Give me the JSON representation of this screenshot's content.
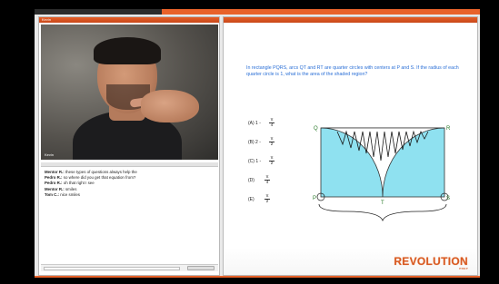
{
  "app": {
    "menu_label": "",
    "bottom_accent": "#e8622a"
  },
  "left": {
    "title": "Kevin",
    "video": {
      "caption": "Kevin"
    },
    "chat": {
      "header": "",
      "messages": [
        {
          "name": "",
          "text": ""
        },
        {
          "name": "Mentor R.:",
          "text": "these types of questions always help the"
        },
        {
          "name": "Pedro R.:",
          "text": "so where did you get that equation from?"
        },
        {
          "name": "Pedro R.:",
          "text": "oh that right I see"
        },
        {
          "name": "Mentor R.:",
          "text": "smiles"
        },
        {
          "name": "Tom C.:",
          "text": "nice smiles"
        }
      ],
      "send_label": ""
    }
  },
  "right": {
    "title": "",
    "question": "In rectangle PQRS, arcs QT and RT are quarter circles with centers at P and S. If the radius of each quarter circle is 1, what is the area of the shaded region?",
    "choices": [
      {
        "label": "(A)  1 -",
        "num": "π",
        "den": "4"
      },
      {
        "label": "(B)  2 -",
        "num": "π",
        "den": "2"
      },
      {
        "label": "(C)  1 -",
        "num": "π",
        "den": "2"
      },
      {
        "label": "(D)",
        "num": "π",
        "den": "4"
      },
      {
        "label": "(E)",
        "num": "π",
        "den": "2"
      }
    ],
    "figure": {
      "points": [
        "Q",
        "R",
        "P",
        "T",
        "S"
      ],
      "fill_color": "#8fe1f0"
    },
    "logo": {
      "text": "REVOLUTION",
      "sub": "PREP"
    }
  }
}
